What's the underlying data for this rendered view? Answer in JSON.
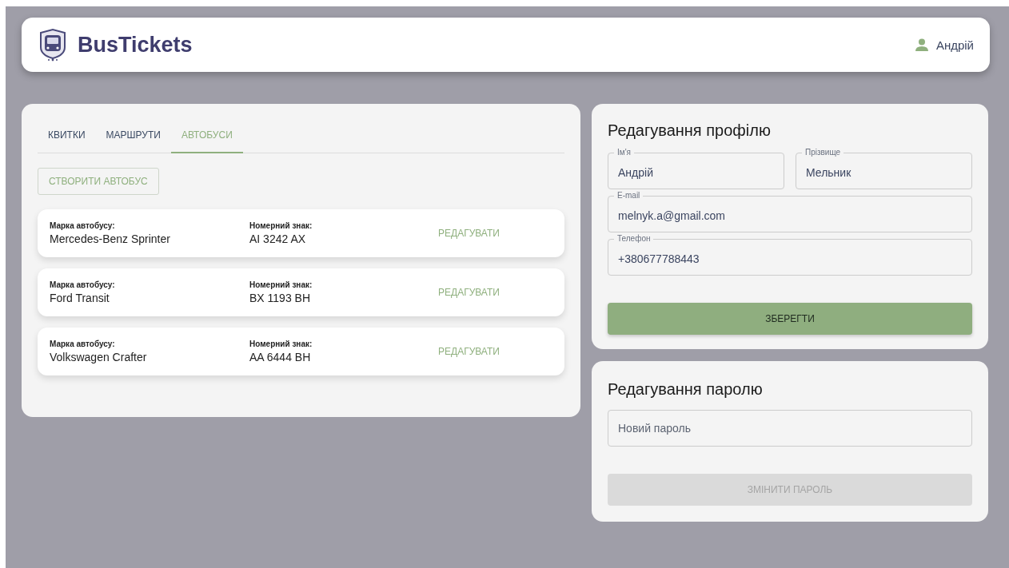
{
  "header": {
    "logo": "BusTickets",
    "user": "Андрій"
  },
  "tabs": [
    {
      "label": "КВИТКИ",
      "selected": false
    },
    {
      "label": "МАРШРУТИ",
      "selected": false
    },
    {
      "label": "АВТОБУСИ",
      "selected": true
    }
  ],
  "create_button": "СТВОРИТИ АВТОБУС",
  "buses": [
    {
      "brand_label": "Марка автобусу:",
      "brand": "Mercedes-Benz Sprinter",
      "plate_label": "Номерний знак:",
      "plate": "AI 3242 AX",
      "action": "РЕДАГУВАТИ"
    },
    {
      "brand_label": "Марка автобусу:",
      "brand": "Ford Transit",
      "plate_label": "Номерний знак:",
      "plate": "BX 1193 BH",
      "action": "РЕДАГУВАТИ"
    },
    {
      "brand_label": "Марка автобусу:",
      "brand": "Volkswagen Crafter",
      "plate_label": "Номерний знак:",
      "plate": "AA 6444 BH",
      "action": "РЕДАГУВАТИ"
    }
  ],
  "profile": {
    "title": "Редагування профілю",
    "rows": [
      [
        {
          "label": "Ім'я",
          "value": "Андрій"
        },
        {
          "label": "Прізвище",
          "value": "Мельник"
        }
      ],
      [
        {
          "label": "E-mail",
          "value": "melnyk.a@gmail.com"
        }
      ],
      [
        {
          "label": "Телефон",
          "value": "+380677788443"
        }
      ]
    ],
    "save": {
      "label": "ЗБЕРЕГТИ",
      "disabled": false
    }
  },
  "password": {
    "title": "Редагування паролю",
    "placeholder": "Новий пароль",
    "button": {
      "label": "ЗМІНИТИ ПАРОЛЬ",
      "disabled": true
    }
  }
}
